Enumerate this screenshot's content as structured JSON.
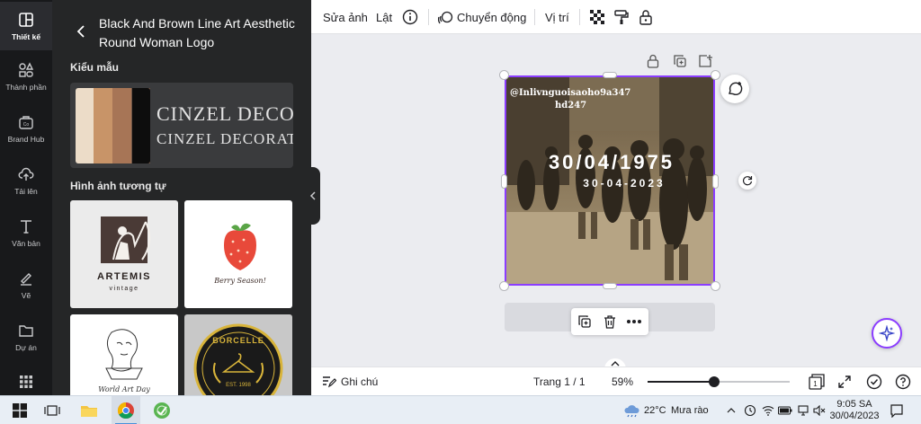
{
  "rail": {
    "items": [
      {
        "label": "Thiết kế",
        "icon": "layout-icon"
      },
      {
        "label": "Thành phần",
        "icon": "elements-icon"
      },
      {
        "label": "Brand Hub",
        "icon": "brand-hub-icon"
      },
      {
        "label": "Tải lên",
        "icon": "upload-cloud-icon"
      },
      {
        "label": "Văn bản",
        "icon": "text-icon"
      },
      {
        "label": "Vẽ",
        "icon": "draw-pen-icon"
      },
      {
        "label": "Dự án",
        "icon": "folder-icon"
      },
      {
        "label": "",
        "icon": "apps-grid-icon"
      }
    ]
  },
  "panel": {
    "title": "Black And Brown Line Art Aesthetic Round Woman Logo",
    "styles_label": "Kiểu mẫu",
    "style_card": {
      "palette": [
        "#ecdcc8",
        "#c89468",
        "#a77556",
        "#6d5547",
        "#0d0d0d"
      ],
      "font_line_1": "CINZEL DECO",
      "font_line_2": "CINZEL DECORAT"
    },
    "similar_label": "Hình ảnh tương tự",
    "thumbs": [
      {
        "title": "ARTEMIS",
        "sub": "vintage"
      },
      {
        "title": "Berry Season!"
      },
      {
        "title": "World Art Day"
      },
      {
        "title": "BORCELLE",
        "sub": "EST. 1998"
      }
    ]
  },
  "toolbar": {
    "edit_image": "Sửa ảnh",
    "flip": "Lật",
    "animate": "Chuyển động",
    "position": "Vị trí"
  },
  "design": {
    "watermark_line1": "@Inlivnguoisaoho9a347",
    "watermark_line2": "hd247",
    "headline": "30/04/1975",
    "subline": "30-04-2023"
  },
  "bottombar": {
    "notes": "Ghi chú",
    "page": "Trang 1 / 1",
    "zoom": "59%",
    "zoom_fraction": 0.47,
    "page_count": "1"
  },
  "taskbar": {
    "temperature": "22°C",
    "weather": "Mưa rào",
    "time": "9:05 SA",
    "date": "30/04/2023"
  },
  "colors": {
    "accent": "#8b3dff",
    "dark_rail": "#18191b",
    "panel_bg": "#252627"
  }
}
